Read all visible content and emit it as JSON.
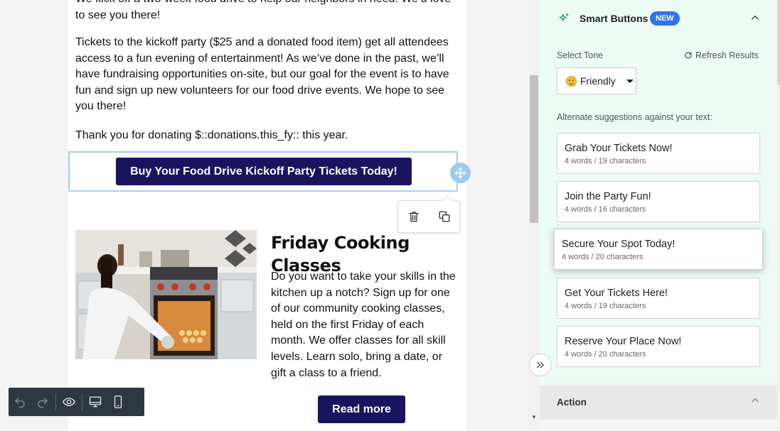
{
  "email": {
    "cut_paragraph": "We kick off a two-week food drive to help our neighbors in need. We’d love to see you there!",
    "tickets_paragraph": "Tickets to the kickoff party ($25 and a donated food item) get all attendees access to a fun evening of entertainment! As we’ve done in the past, we’ll have fundraising opportunities on-site, but our goal for the event is to have fun and sign up new volunteers for our food drive events. We hope to see you there!",
    "thanks_paragraph": "Thank you for donating $::donations.this_fy:: this year.",
    "cta_button": "Buy Your Food Drive Kickoff Party Tickets Today!",
    "section_title": "Friday Cooking Classes",
    "section_body": "Do you want to take your skills in the kitchen up a notch? Sign up for one of our community cooking classes, held on the first Friday of each month. We offer classes for all skill levels. Learn solo, bring a date, or gift a class to a friend.",
    "read_more": "Read more",
    "button_color": "#18155e"
  },
  "block_toolbar": {
    "icons": [
      "trash-icon",
      "duplicate-icon",
      "move-icon"
    ]
  },
  "bottom_toolbar": {
    "icons": [
      "undo-icon",
      "redo-icon",
      "preview-eye-icon",
      "desktop-icon",
      "mobile-icon"
    ]
  },
  "panel": {
    "smart_buttons": {
      "title": "Smart Buttons",
      "badge": "NEW",
      "select_tone_label": "Select Tone",
      "refresh_label": "Refresh Results",
      "tone_value": "Friendly",
      "alt_label": "Alternate suggestions against your text:",
      "suggestions": [
        {
          "title": "Grab Your Tickets Now!",
          "meta": "4 words / 19 characters"
        },
        {
          "title": "Join the Party Fun!",
          "meta": "4 words / 16 characters"
        },
        {
          "title": "Secure Your Spot Today!",
          "meta": "4 words / 20 characters"
        },
        {
          "title": "Get Your Tickets Here!",
          "meta": "4 words / 19 characters"
        },
        {
          "title": "Reserve Your Place Now!",
          "meta": "4 words / 20 characters"
        }
      ]
    },
    "action": {
      "label": "Action"
    },
    "accent_color": "#2f73e8",
    "card_bg": "#ecfbf4"
  }
}
